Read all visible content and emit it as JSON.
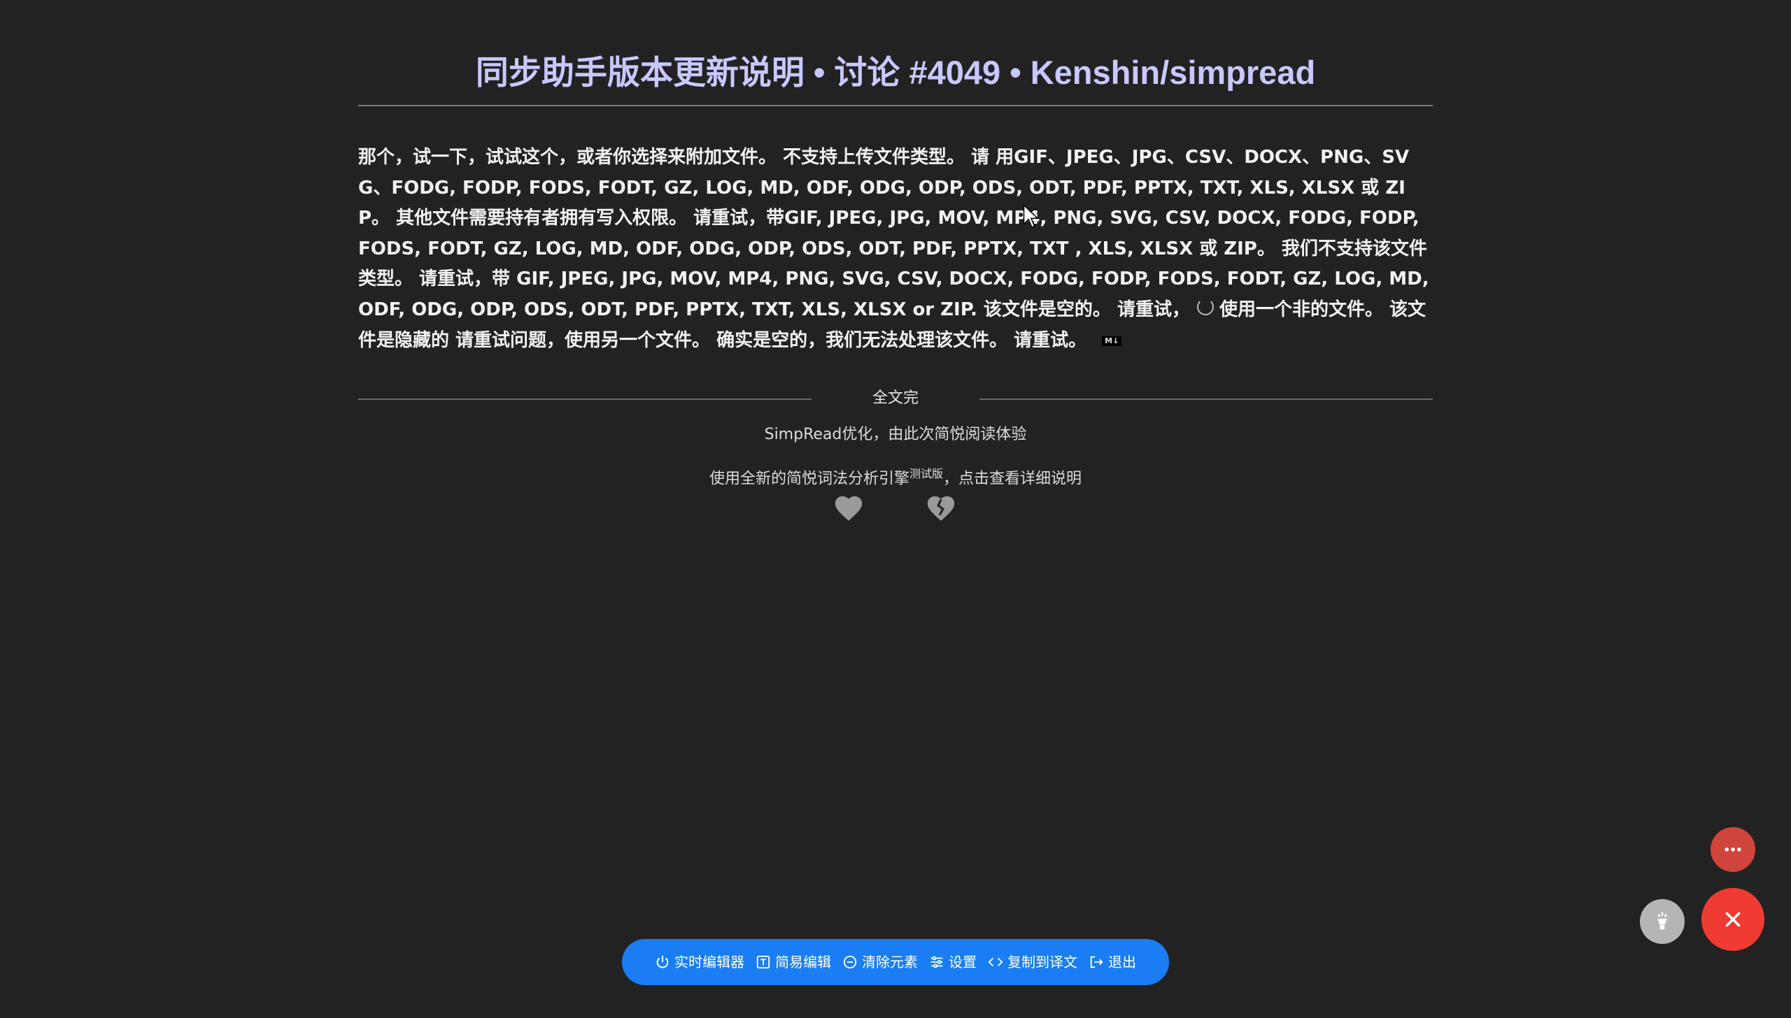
{
  "article": {
    "title": "同步助手版本更新说明 • 讨论 #4049 • Kenshin/simpread",
    "body_part1": "那个，试一下，试试这个，或者你选择来附加文件。 不支持上传文件类型。 请 用GIF、JPEG、JPG、CSV、DOCX、PNG、SVG、FODG, FODP, FODS, FODT, GZ, LOG, MD, ODF, ODG, ODP, ODS, ODT, PDF, PPTX, TXT, XLS, XLSX 或 ZIP。 其他文件需要持有者拥有写入权限。 请重试，带GIF, JPEG, JPG, MOV, MP4, PNG, SVG, CSV, DOCX, FODG, FODP, FODS, FODT, GZ, LOG, MD, ODF, ODG, ODP, ODS, ODT, PDF, PPTX, TXT , XLS, XLSX 或 ZIP。 我们不支持该文件类型。 请重试，带 GIF, JPEG, JPG, MOV, MP4, PNG, SVG, CSV, DOCX, FODG, FODP, FODS, FODT, GZ, LOG, MD, ODF, ODG, ODP, ODS, ODT, PDF, PPTX, TXT, XLS, XLSX or ZIP. 该文件是空的。 请重试，",
    "body_part2": "使用一个非的文件。 该文件是隐藏的 请重试问题，使用另一个文件。 确实是空的，我们无法处理该文件。 请重试。",
    "md_badge": "M↓"
  },
  "footer": {
    "end_label": "全文完",
    "optimized_by": "SimpRead优化，由此次简悦阅读体验",
    "engine_text": "使用全新的简悦词法分析引擎",
    "engine_sup": "测试版",
    "engine_tail": "，点击查看详细说明"
  },
  "toolbar": {
    "items": [
      {
        "label": "实时编辑器",
        "icon": "power-icon"
      },
      {
        "label": "简易编辑",
        "icon": "text-edit-icon"
      },
      {
        "label": "清除元素",
        "icon": "minus-circle-icon"
      },
      {
        "label": "设置",
        "icon": "sliders-icon"
      },
      {
        "label": "复制到译文",
        "icon": "code-icon"
      },
      {
        "label": "退出",
        "icon": "exit-icon"
      }
    ]
  },
  "colors": {
    "background": "#222222",
    "title": "#c8c8ff",
    "toolbar": "#1a7df3",
    "fab_close": "#ef3b33",
    "fab_more": "#d0453b",
    "fab_bulb": "#b5b5b5"
  }
}
